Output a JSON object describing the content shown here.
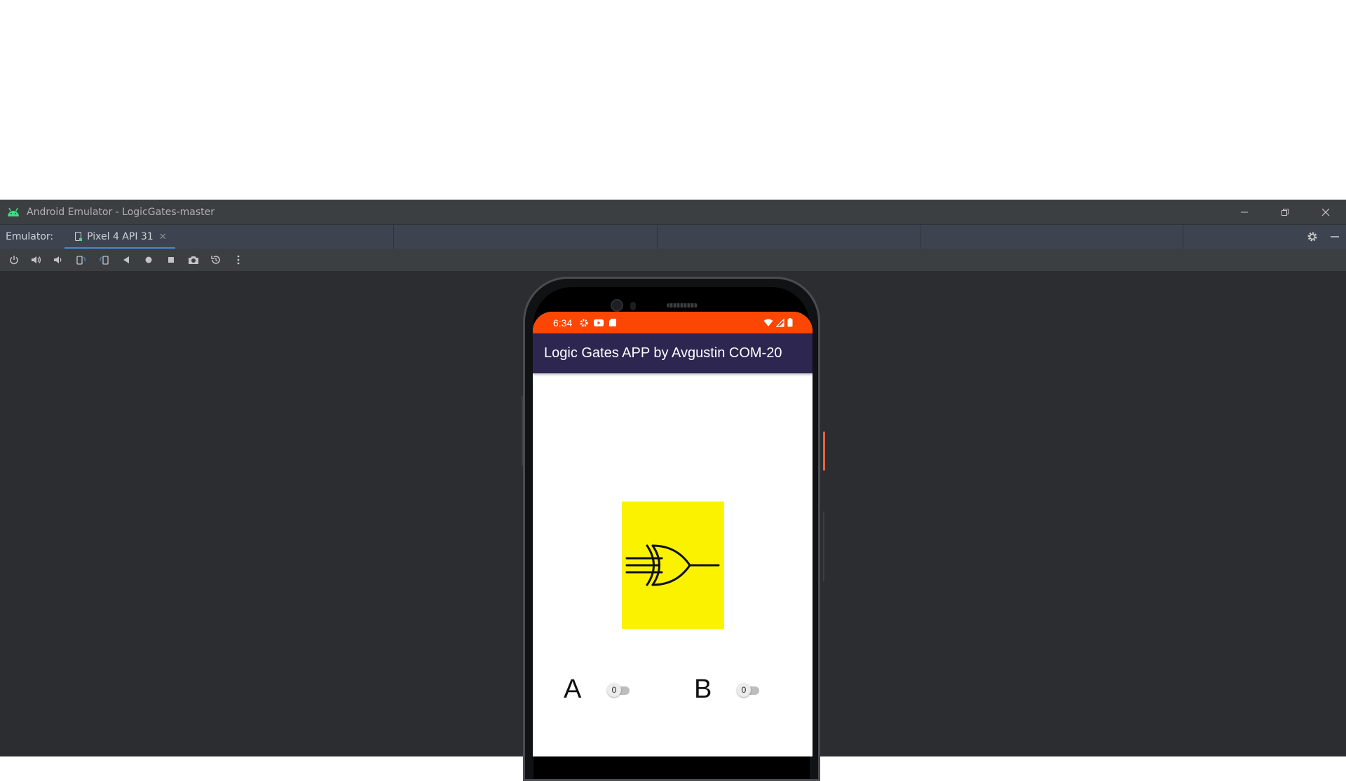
{
  "window": {
    "title": "Android Emulator - LogicGates-master"
  },
  "tabbar": {
    "label": "Emulator:",
    "tabs": [
      {
        "label": "Pixel 4 API 31"
      }
    ]
  },
  "toolbar": {
    "buttons": [
      "power-icon",
      "volume-up-icon",
      "volume-down-icon",
      "rotate-left-icon",
      "rotate-right-icon",
      "back-icon",
      "home-icon",
      "overview-icon",
      "screenshot-icon",
      "snapshot-icon",
      "more-icon"
    ]
  },
  "phone": {
    "statusbar": {
      "time": "6:34",
      "color": "#fb4703"
    },
    "appbar": {
      "title": "Logic Gates APP by Avgustin COM-20",
      "color": "#2d2650"
    },
    "gate": {
      "icon": "xor-gate-icon",
      "background": "#fbf200"
    },
    "inputs": [
      {
        "label": "A",
        "switch_text": "0",
        "on": false
      },
      {
        "label": "B",
        "switch_text": "0",
        "on": false
      }
    ]
  }
}
